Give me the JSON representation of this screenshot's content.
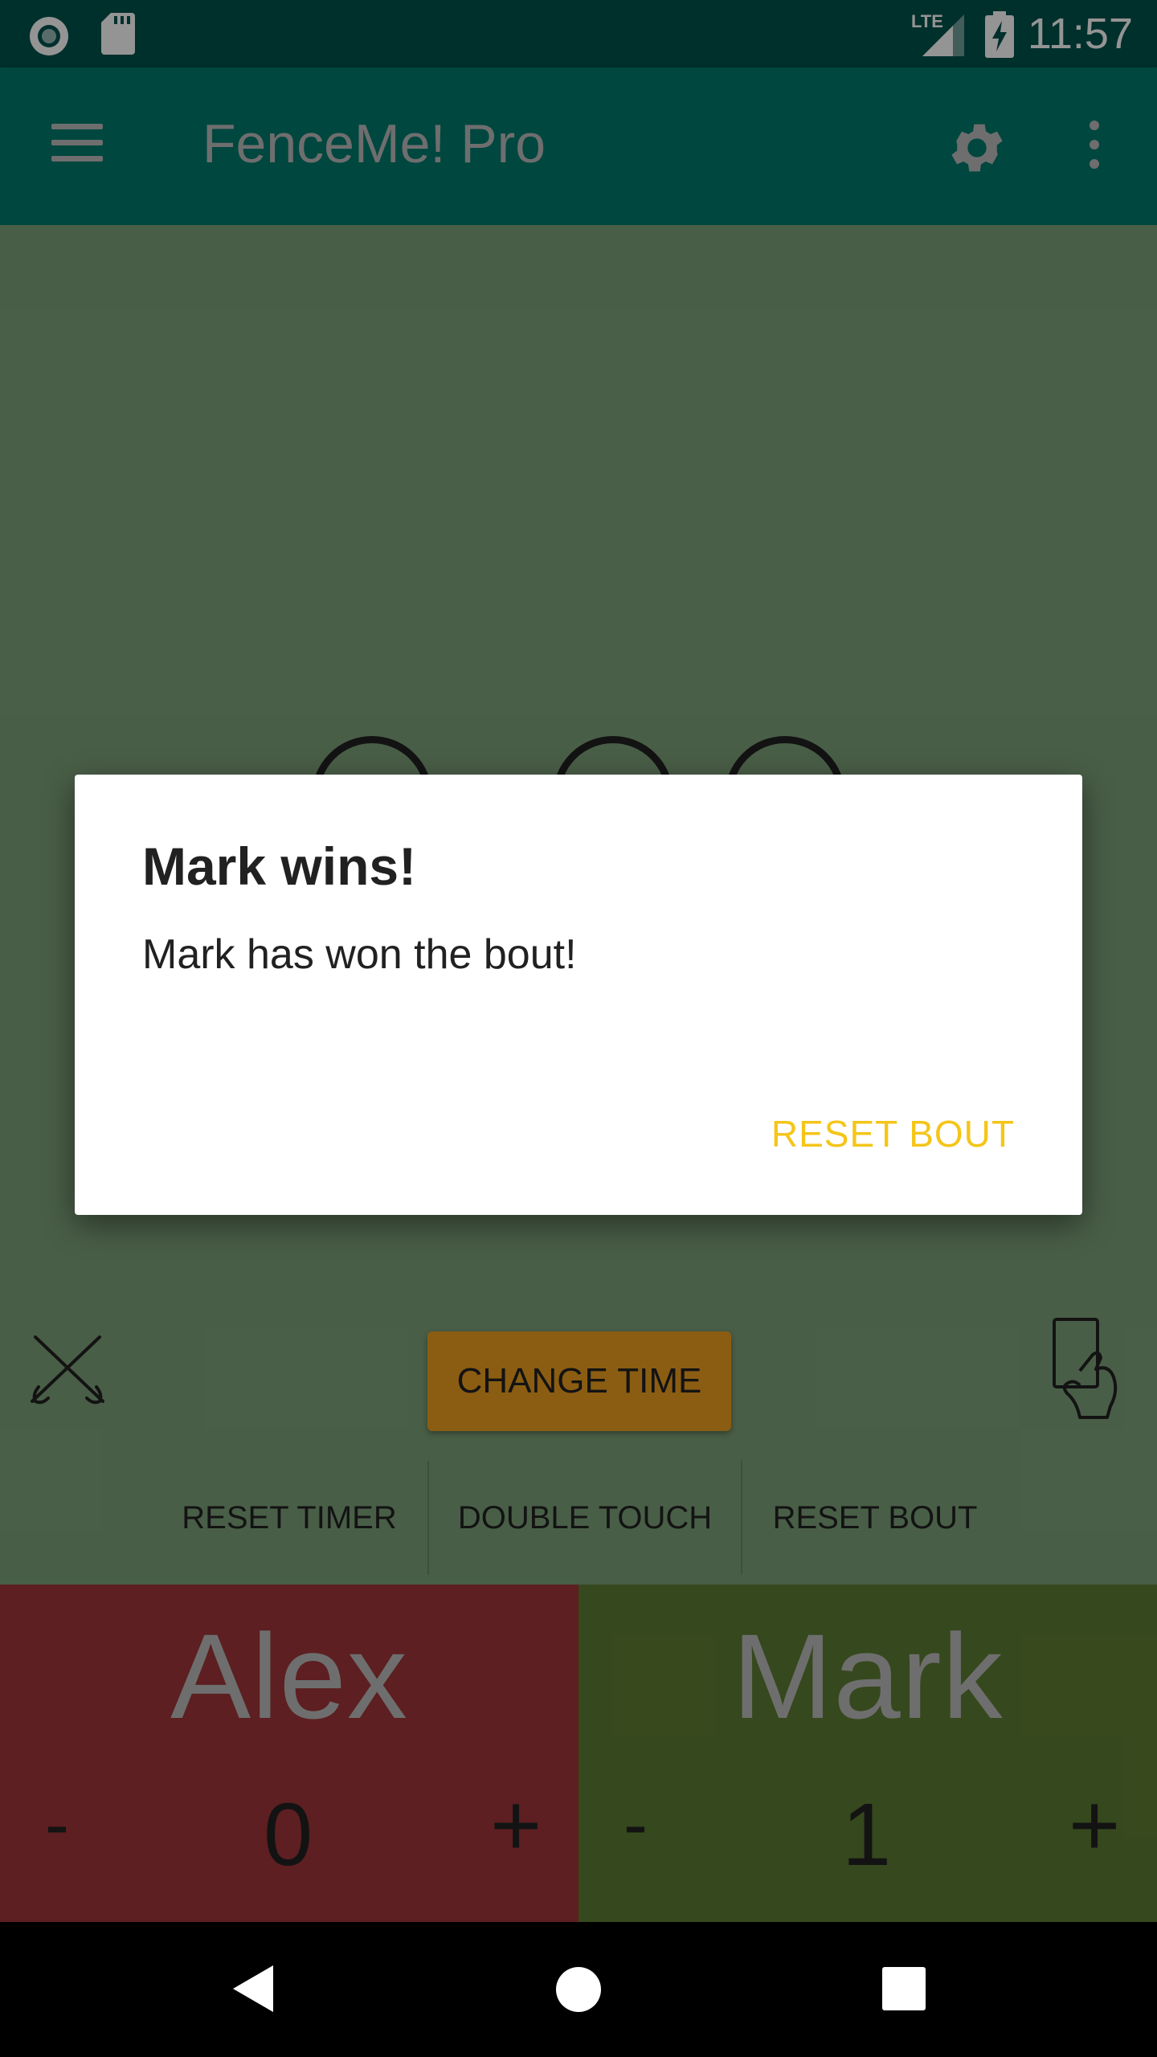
{
  "status_bar": {
    "time": "11:57",
    "network": "LTE",
    "icons": [
      "radio-dot-icon",
      "sd-card-icon",
      "signal-icon",
      "battery-charging-icon"
    ]
  },
  "app_bar": {
    "title": "FenceMe! Pro",
    "icons": [
      "menu-icon",
      "gear-icon",
      "more-vert-icon"
    ]
  },
  "controls": {
    "change_time_label": "CHANGE TIME",
    "actions": [
      "RESET TIMER",
      "DOUBLE TOUCH",
      "RESET BOUT"
    ],
    "left_icon": "crossed-swords-icon",
    "right_icon": "card-hand-icon"
  },
  "fencers": [
    {
      "name": "Alex",
      "score": "0",
      "minus": "-",
      "plus": "+",
      "color": "#a0363a"
    },
    {
      "name": "Mark",
      "score": "1",
      "minus": "-",
      "plus": "+",
      "color": "#5e7d32"
    }
  ],
  "dialog": {
    "title": "Mark wins!",
    "message": "Mark has won the bout!",
    "button": "RESET BOUT",
    "button_color": "#f5c518"
  },
  "nav_bar": {
    "icons": [
      "back-icon",
      "home-icon",
      "recents-icon"
    ]
  }
}
